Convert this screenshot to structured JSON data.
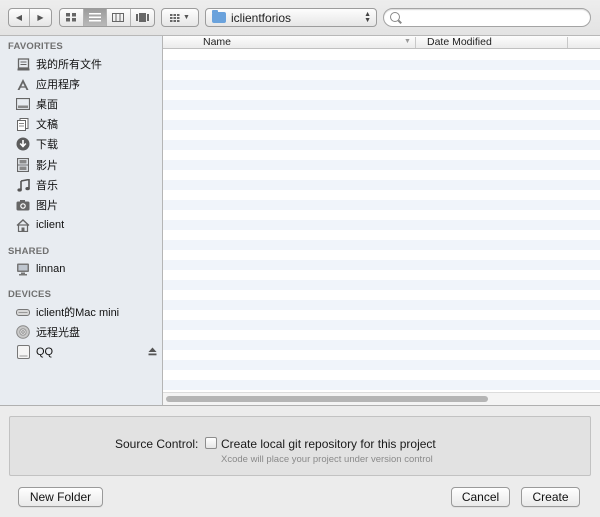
{
  "toolbar": {
    "path": "iclientforios",
    "search_placeholder": ""
  },
  "sidebar": {
    "sections": [
      {
        "title": "FAVORITES",
        "items": [
          {
            "label": "我的所有文件",
            "icon": "all-files-icon"
          },
          {
            "label": "应用程序",
            "icon": "applications-icon"
          },
          {
            "label": "桌面",
            "icon": "desktop-icon"
          },
          {
            "label": "文稿",
            "icon": "documents-icon"
          },
          {
            "label": "下载",
            "icon": "downloads-icon"
          },
          {
            "label": "影片",
            "icon": "movies-icon"
          },
          {
            "label": "音乐",
            "icon": "music-icon"
          },
          {
            "label": "图片",
            "icon": "pictures-icon"
          },
          {
            "label": "iclient",
            "icon": "home-icon"
          }
        ]
      },
      {
        "title": "SHARED",
        "items": [
          {
            "label": "linnan",
            "icon": "computer-icon"
          }
        ]
      },
      {
        "title": "DEVICES",
        "items": [
          {
            "label": "iclient的Mac mini",
            "icon": "mac-mini-icon"
          },
          {
            "label": "远程光盘",
            "icon": "remote-disc-icon"
          },
          {
            "label": "QQ",
            "icon": "disk-icon"
          }
        ]
      }
    ]
  },
  "filelist": {
    "columns": [
      "Name",
      "Date Modified"
    ]
  },
  "accessory": {
    "label": "Source Control:",
    "checkbox_label": "Create local git repository for this project",
    "checkbox_checked": false,
    "subtitle": "Xcode will place your project under version control"
  },
  "buttons": {
    "new_folder": "New Folder",
    "cancel": "Cancel",
    "create": "Create"
  }
}
